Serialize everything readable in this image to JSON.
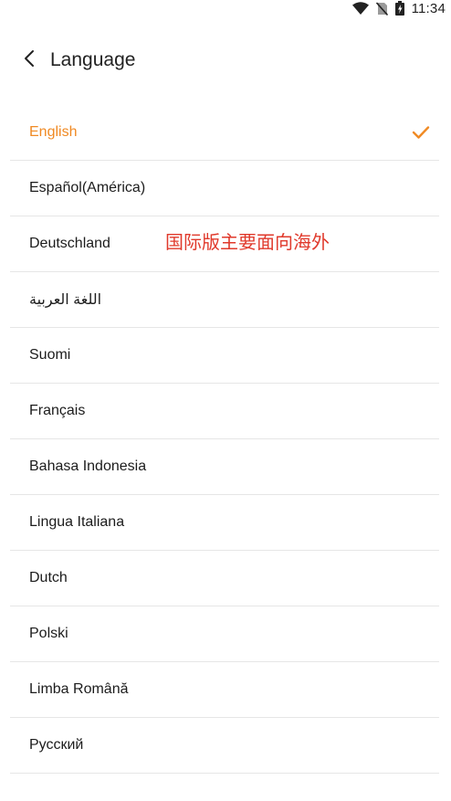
{
  "status_bar": {
    "time": "11:34",
    "icons": [
      "wifi-icon",
      "no-sim-icon",
      "battery-charging-icon"
    ]
  },
  "header": {
    "back_icon": "chevron-left-icon",
    "title": "Language"
  },
  "languages": [
    {
      "label": "English",
      "selected": true
    },
    {
      "label": "Español(América)",
      "selected": false
    },
    {
      "label": "Deutschland",
      "selected": false
    },
    {
      "label": "اللغة العربية",
      "selected": false
    },
    {
      "label": "Suomi",
      "selected": false
    },
    {
      "label": "Français",
      "selected": false
    },
    {
      "label": "Bahasa Indonesia",
      "selected": false
    },
    {
      "label": "Lingua Italiana",
      "selected": false
    },
    {
      "label": "Dutch",
      "selected": false
    },
    {
      "label": "Polski",
      "selected": false
    },
    {
      "label": "Limba Română",
      "selected": false
    },
    {
      "label": "Русский",
      "selected": false
    }
  ],
  "colors": {
    "accent": "#f08a24",
    "annotation": "#e0392b",
    "divider": "#e6e6e6"
  },
  "annotation": "国际版主要面向海外"
}
